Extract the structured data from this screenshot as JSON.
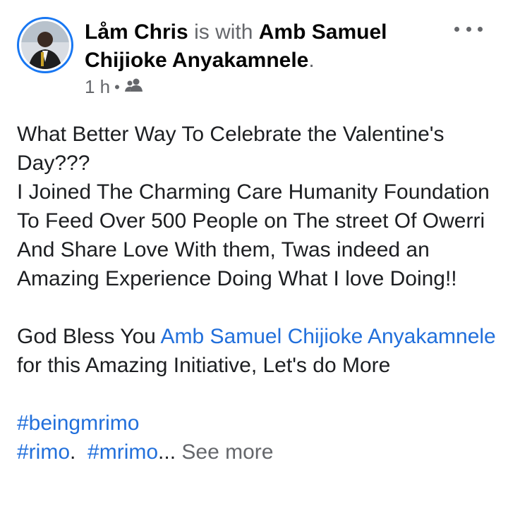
{
  "post": {
    "author": "Låm Chris",
    "with_text": "is with",
    "tagged": "Amb Samuel Chijioke Anyakamnele",
    "period": ".",
    "time": "1 h",
    "audience_icon": "friends-icon",
    "more_icon": "more-options-icon",
    "body": {
      "line1": "What Better Way To Celebrate the Valentine's Day???",
      "line2": "I Joined The Charming Care Humanity Foundation To Feed Over 500 People on The street Of Owerri And Share Love With them, Twas indeed an Amazing Experience Doing What I love Doing!!",
      "bless_prefix": "God Bless You ",
      "bless_link": "Amb Samuel Chijioke Anyakamnele",
      "bless_suffix": " for this Amazing Initiative, Let's do More",
      "hashtag1": "#beingmrimo",
      "hashtag2": "#rimo",
      "hashtag3": "#mrimo",
      "ellipsis": "...",
      "see_more": "See more"
    }
  },
  "colors": {
    "link": "#216fdb",
    "muted": "#65676b",
    "avatar_ring": "#1877f2"
  }
}
